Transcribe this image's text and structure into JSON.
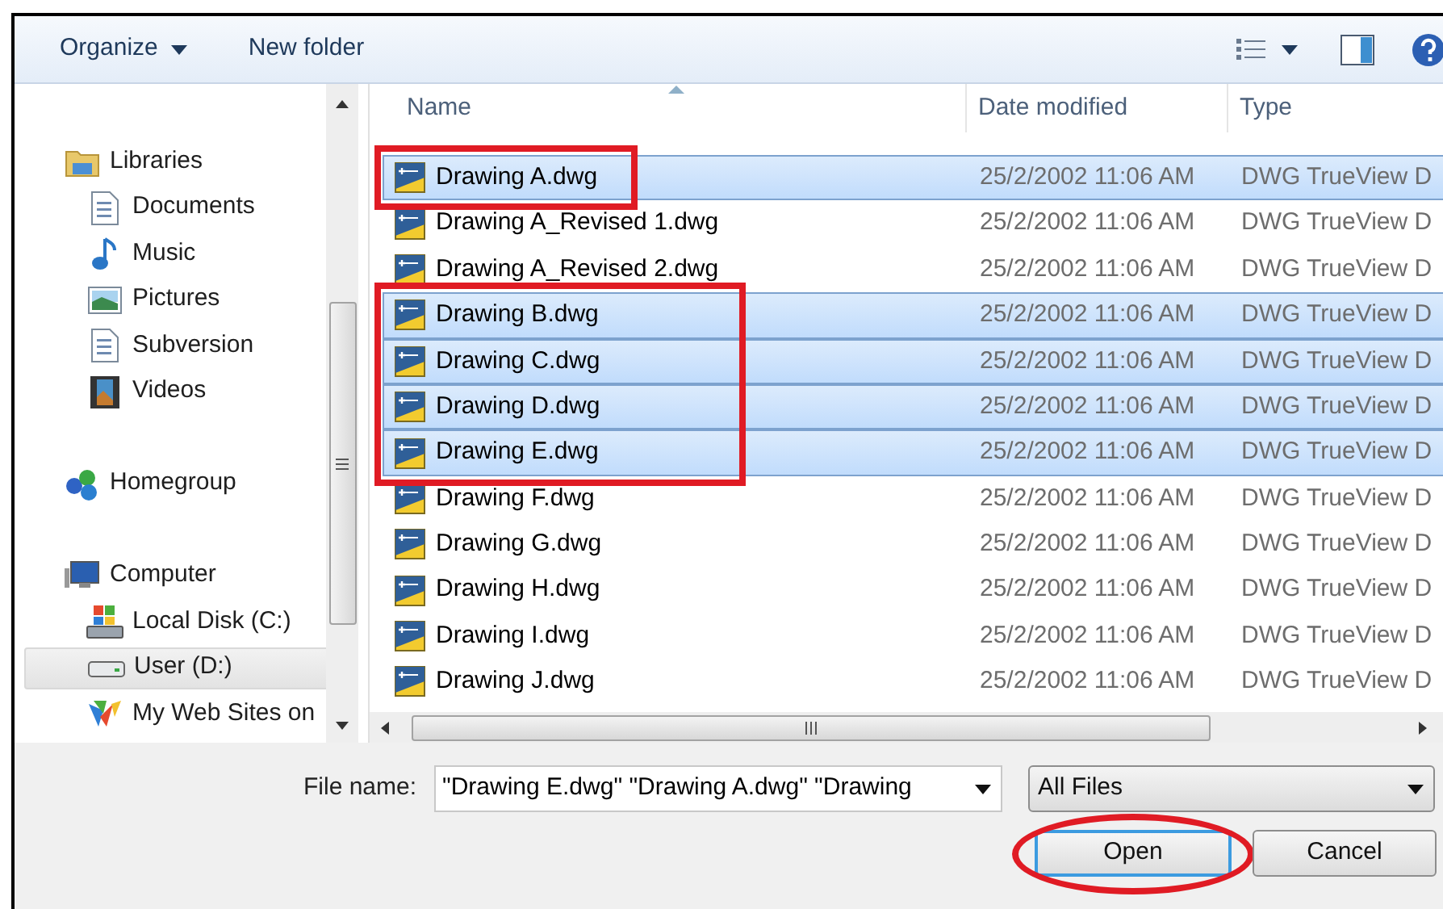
{
  "toolbar": {
    "organize": "Organize",
    "new_folder": "New folder"
  },
  "sidebar": {
    "items": [
      {
        "label": "Libraries",
        "kind": "library",
        "selected": false,
        "children": [
          {
            "label": "Documents",
            "kind": "document",
            "selected": false
          },
          {
            "label": "Music",
            "kind": "music",
            "selected": false
          },
          {
            "label": "Pictures",
            "kind": "pictures",
            "selected": false
          },
          {
            "label": "Subversion",
            "kind": "document",
            "selected": false
          },
          {
            "label": "Videos",
            "kind": "videos",
            "selected": false
          }
        ]
      },
      {
        "label": "Homegroup",
        "kind": "homegroup",
        "selected": false
      },
      {
        "label": "Computer",
        "kind": "computer",
        "selected": false,
        "children": [
          {
            "label": "Local Disk (C:)",
            "kind": "disk",
            "selected": false
          },
          {
            "label": "User (D:)",
            "kind": "drive",
            "selected": true
          },
          {
            "label": "My Web Sites on",
            "kind": "web",
            "selected": false
          }
        ]
      }
    ]
  },
  "table": {
    "columns": [
      "Name",
      "Date modified",
      "Type"
    ],
    "rows": [
      {
        "name": "Drawing A.dwg",
        "date": "25/2/2002 11:06 AM",
        "type": "DWG TrueView D",
        "selected": true,
        "highlighted": true
      },
      {
        "name": "Drawing A_Revised 1.dwg",
        "date": "25/2/2002 11:06 AM",
        "type": "DWG TrueView D",
        "selected": false,
        "highlighted": false
      },
      {
        "name": "Drawing A_Revised 2.dwg",
        "date": "25/2/2002 11:06 AM",
        "type": "DWG TrueView D",
        "selected": false,
        "highlighted": false
      },
      {
        "name": "Drawing B.dwg",
        "date": "25/2/2002 11:06 AM",
        "type": "DWG TrueView D",
        "selected": true,
        "highlighted": true
      },
      {
        "name": "Drawing C.dwg",
        "date": "25/2/2002 11:06 AM",
        "type": "DWG TrueView D",
        "selected": true,
        "highlighted": true
      },
      {
        "name": "Drawing D.dwg",
        "date": "25/2/2002 11:06 AM",
        "type": "DWG TrueView D",
        "selected": true,
        "highlighted": true
      },
      {
        "name": "Drawing E.dwg",
        "date": "25/2/2002 11:06 AM",
        "type": "DWG TrueView D",
        "selected": true,
        "highlighted": true
      },
      {
        "name": "Drawing F.dwg",
        "date": "25/2/2002 11:06 AM",
        "type": "DWG TrueView D",
        "selected": false,
        "highlighted": false
      },
      {
        "name": "Drawing G.dwg",
        "date": "25/2/2002 11:06 AM",
        "type": "DWG TrueView D",
        "selected": false,
        "highlighted": false
      },
      {
        "name": "Drawing H.dwg",
        "date": "25/2/2002 11:06 AM",
        "type": "DWG TrueView D",
        "selected": false,
        "highlighted": false
      },
      {
        "name": "Drawing I.dwg",
        "date": "25/2/2002 11:06 AM",
        "type": "DWG TrueView D",
        "selected": false,
        "highlighted": false
      },
      {
        "name": "Drawing J.dwg",
        "date": "25/2/2002 11:06 AM",
        "type": "DWG TrueView D",
        "selected": false,
        "highlighted": false
      }
    ]
  },
  "file_name": {
    "label": "File name:",
    "value": "\"Drawing E.dwg\" \"Drawing A.dwg\" \"Drawing"
  },
  "file_type": {
    "value": "All Files"
  },
  "buttons": [
    {
      "label": "Open",
      "circled": true
    },
    {
      "label": "Cancel",
      "circled": false
    }
  ]
}
